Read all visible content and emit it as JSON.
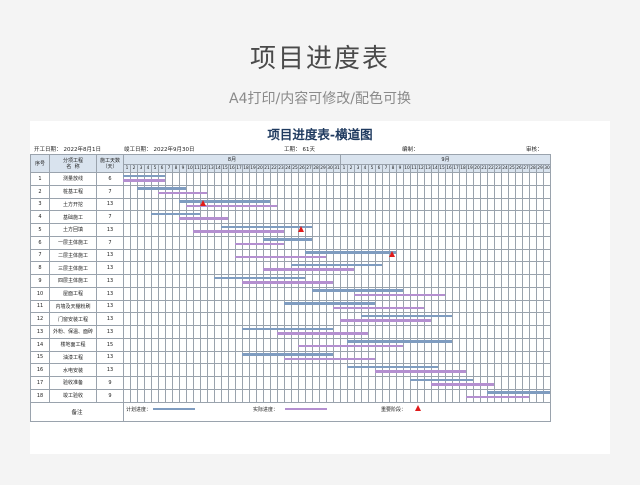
{
  "hero": {
    "title": "项目进度表",
    "subtitle": "A4打印/内容可修改/配色可换"
  },
  "sheet": {
    "title": "项目进度表-横道图",
    "start_label": "开工日期：",
    "start_value": "2022年8月1日",
    "end_label": "竣工日期：",
    "end_value": "2022年9月30日",
    "duration_label": "工期：",
    "duration_value": "61天",
    "editor_label": "编制：",
    "reviewer_label": "审核："
  },
  "columns": {
    "index": "序号",
    "name": "分项工程\n名  称",
    "days": "施工天数\n（天）"
  },
  "months": [
    {
      "label": "8月",
      "days": 31
    },
    {
      "label": "9月",
      "days": 30
    }
  ],
  "tasks": [
    {
      "index": "1",
      "name": "测量放线",
      "days": "6",
      "plan": [
        1,
        6
      ],
      "actual": [
        1,
        6
      ]
    },
    {
      "index": "2",
      "name": "桩基工程",
      "days": "7",
      "plan": [
        3,
        9
      ],
      "actual": [
        6,
        12
      ]
    },
    {
      "index": "3",
      "name": "土方开挖",
      "days": "13",
      "plan": [
        9,
        21
      ],
      "actual": [
        10,
        22
      ],
      "milestone": 12
    },
    {
      "index": "4",
      "name": "基础施工",
      "days": "7",
      "plan": [
        5,
        11
      ],
      "actual": [
        9,
        15
      ]
    },
    {
      "index": "5",
      "name": "土方回填",
      "days": "13",
      "plan": [
        15,
        27
      ],
      "actual": [
        11,
        23
      ],
      "milestone": 26
    },
    {
      "index": "6",
      "name": "一层主体施工",
      "days": "7",
      "plan": [
        21,
        27
      ],
      "actual": [
        17,
        23
      ]
    },
    {
      "index": "7",
      "name": "二层主体施工",
      "days": "13",
      "plan": [
        27,
        39
      ],
      "actual": [
        17,
        29
      ],
      "milestone": 39
    },
    {
      "index": "8",
      "name": "三层主体施工",
      "days": "13",
      "plan": [
        25,
        37
      ],
      "actual": [
        21,
        33
      ]
    },
    {
      "index": "9",
      "name": "四层主体施工",
      "days": "13",
      "plan": [
        14,
        26
      ],
      "actual": [
        18,
        30
      ]
    },
    {
      "index": "10",
      "name": "屋面工程",
      "days": "13",
      "plan": [
        28,
        40
      ],
      "actual": [
        34,
        46
      ]
    },
    {
      "index": "11",
      "name": "内墙及天棚粉刷",
      "days": "13",
      "plan": [
        24,
        36
      ],
      "actual": [
        31,
        43
      ]
    },
    {
      "index": "12",
      "name": "门窗安装工程",
      "days": "13",
      "plan": [
        35,
        47
      ],
      "actual": [
        32,
        44
      ]
    },
    {
      "index": "13",
      "name": "外粉、保温、面砖",
      "days": "13",
      "plan": [
        18,
        30
      ],
      "actual": [
        23,
        35
      ]
    },
    {
      "index": "14",
      "name": "楼地面工程",
      "days": "15",
      "plan": [
        33,
        47
      ],
      "actual": [
        26,
        40
      ]
    },
    {
      "index": "15",
      "name": "油漆工程",
      "days": "13",
      "plan": [
        18,
        30
      ],
      "actual": [
        24,
        36
      ]
    },
    {
      "index": "16",
      "name": "水电安装",
      "days": "13",
      "plan": [
        33,
        45
      ],
      "actual": [
        37,
        49
      ]
    },
    {
      "index": "17",
      "name": "验收准备",
      "days": "9",
      "plan": [
        42,
        50
      ],
      "actual": [
        45,
        53
      ]
    },
    {
      "index": "18",
      "name": "竣工验收",
      "days": "9",
      "plan": [
        53,
        61
      ],
      "actual": [
        50,
        58
      ]
    }
  ],
  "legend": {
    "remark": "备注",
    "plan": "计划进度：",
    "actual": "实际进度：",
    "milestone": "重要阶段："
  },
  "colors": {
    "plan": "#7f9cc0",
    "actual": "#b48fd0",
    "milestone": "#e01b1b",
    "header": "#d9e3ee"
  }
}
